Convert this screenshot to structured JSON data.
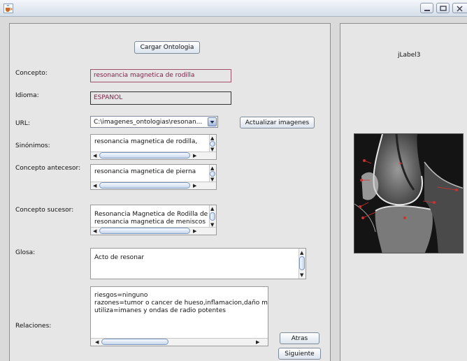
{
  "buttons": {
    "cargar": "Cargar Ontologia",
    "actualizar": "Actualizar imagenes",
    "atras": "Atras",
    "siguiente": "Siguiente"
  },
  "labels": {
    "concepto": "Concepto:",
    "idioma": "Idioma:",
    "url": "URL:",
    "sinonimos": "Sinónimos:",
    "antecesor": "Concepto antecesor:",
    "sucesor": "Concepto sucesor:",
    "glosa": "Glosa:",
    "relaciones": "Relaciones:",
    "jlabel": "jLabel3"
  },
  "fields": {
    "concepto": "resonancia magnetica de rodilla",
    "idioma": "ESPANOL",
    "url": "C:\\imagenes_ontologias\\resonan..."
  },
  "lists": {
    "sinonimos": [
      "resonancia magnetica de rodilla,"
    ],
    "antecesor": [
      "resonancia magnetica de pierna"
    ],
    "sucesor": [
      "Resonancia Magnetica de Rodilla de",
      "resonancia magnetica de meniscos"
    ],
    "glosa": [
      "Acto de resonar"
    ],
    "relaciones": [
      "riesgos=ninguno",
      "razones=tumor o cancer de hueso,inflamacion,daño mus",
      "utiliza=imanes y ondas de radio potentes"
    ]
  },
  "icons": {
    "app": "java-cup-icon",
    "minimize": "minimize-icon",
    "maximize": "maximize-icon",
    "close": "close-icon",
    "dropdown": "chevron-down-icon"
  },
  "colors": {
    "focus_border": "#a1506a",
    "panel_bg": "#e6e6e6",
    "scroll_thumb": "#c6d6ec"
  }
}
